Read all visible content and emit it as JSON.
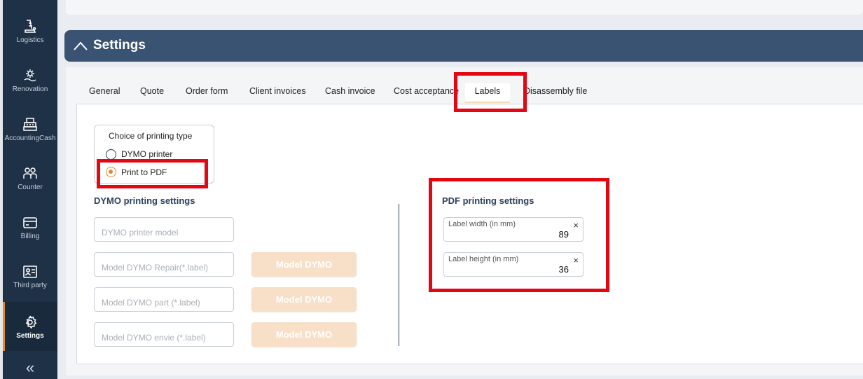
{
  "sidebar": {
    "items": [
      {
        "label": "Logistics",
        "icon": "logistics-icon"
      },
      {
        "label": "Renovation",
        "icon": "renovation-icon"
      },
      {
        "label": "AccountingCash",
        "icon": "cash-register-icon"
      },
      {
        "label": "Counter",
        "icon": "counter-users-icon"
      },
      {
        "label": "Billing",
        "icon": "billing-card-icon"
      },
      {
        "label": "Third party",
        "icon": "id-card-icon"
      },
      {
        "label": "Settings",
        "icon": "gear-icon",
        "active": true
      }
    ],
    "collapse_glyph": "«"
  },
  "header": {
    "title": "Settings"
  },
  "tabs": [
    {
      "label": "General"
    },
    {
      "label": "Quote"
    },
    {
      "label": "Order form"
    },
    {
      "label": "Client invoices"
    },
    {
      "label": "Cash invoice"
    },
    {
      "label": "Cost acceptance"
    },
    {
      "label": "Labels",
      "active": true
    },
    {
      "label": "Disassembly file"
    }
  ],
  "printing_type": {
    "title": "Choice of printing type",
    "options": [
      {
        "label": "DYMO printer",
        "selected": false
      },
      {
        "label": "Print to PDF",
        "selected": true
      }
    ]
  },
  "dymo": {
    "title": "DYMO printing settings",
    "fields": [
      {
        "placeholder": "DYMO printer model"
      },
      {
        "placeholder": "Model DYMO Repair(*.label)",
        "button": "Model DYMO"
      },
      {
        "placeholder": "Model DYMO part (*.label)",
        "button": "Model DYMO"
      },
      {
        "placeholder": "Model DYMO envie (*.label)",
        "button": "Model DYMO"
      }
    ]
  },
  "pdf": {
    "title": "PDF printing settings",
    "fields": [
      {
        "label": "Label width (in mm)",
        "value": "89"
      },
      {
        "label": "Label height (in mm)",
        "value": "36"
      }
    ],
    "clear_glyph": "×"
  },
  "colors": {
    "sidebar_bg": "#1f3147",
    "header_bg": "#3a5373",
    "accent": "#e08a2b",
    "highlight": "#e30613",
    "button_disabled": "#f8dfc7"
  }
}
